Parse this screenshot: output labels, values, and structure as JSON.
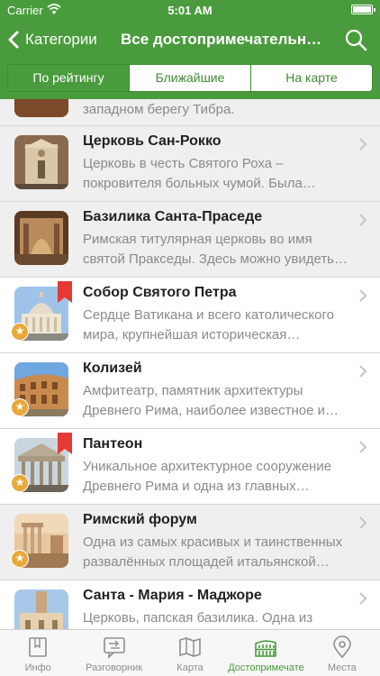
{
  "status": {
    "carrier": "Carrier",
    "time": "5:01 AM"
  },
  "nav": {
    "back_label": "Категории",
    "title": "Все достопримечательности"
  },
  "segments": [
    "По рейтингу",
    "Ближайшие",
    "На карте"
  ],
  "partial_row_text": "западном берегу Тибра.",
  "items": [
    {
      "title": "Церковь Сан-Рокко",
      "desc": "Церковь в честь Святого Роха – покровителя больных чумой. Была…"
    },
    {
      "title": "Базилика Санта-Праседе",
      "desc": "Римская титулярная церковь во имя святой Праксeды. Здесь можно увидеть…"
    },
    {
      "title": "Собор Святого Петра",
      "desc": "Сердце Ватикана и всего католического мира, крупнейшая историческая…"
    },
    {
      "title": "Колизей",
      "desc": "Амфитеатр, памятник архитектуры Древнего Рима, наиболее известное и…"
    },
    {
      "title": "Пантеон",
      "desc": "Уникальное архитектурное сооружение Древнего Рима и одна из главных…"
    },
    {
      "title": "Римский форум",
      "desc": "Одна из самых красивых и таинственных развалённых площадей итальянской…"
    },
    {
      "title": "Санта - Мария - Маджоре",
      "desc": "Церковь, папская базилика. Одна из"
    }
  ],
  "tabs": [
    "Инфо",
    "Разговорник",
    "Карта",
    "Достопримечательности",
    "Места"
  ],
  "colors": {
    "accent": "#4a9b3d",
    "star": "#e8a93a",
    "ribbon": "#e53935"
  }
}
